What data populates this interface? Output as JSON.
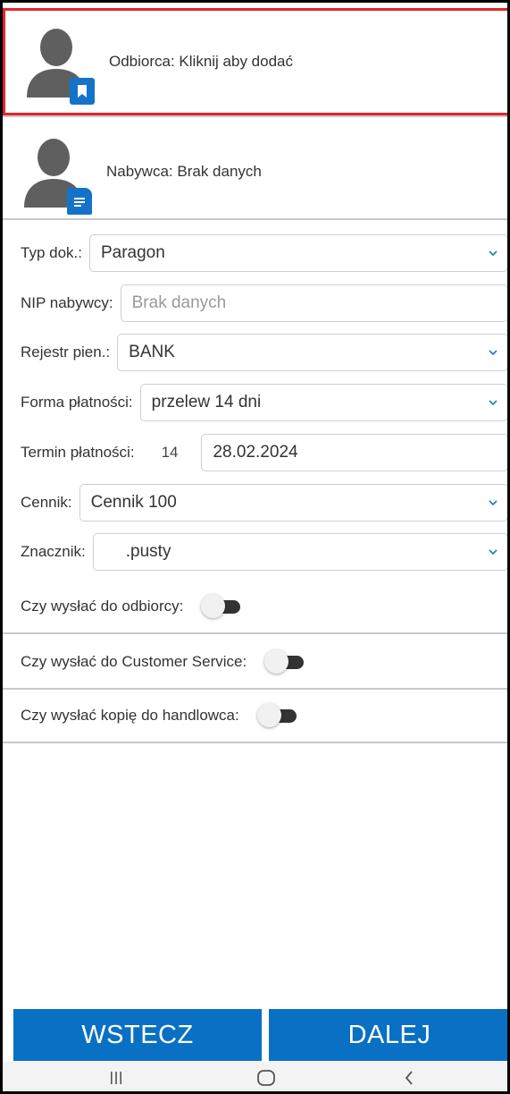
{
  "recipient": {
    "text": "Odbiorca: Kliknij aby dodać",
    "icon": "recipient-card-icon"
  },
  "buyer": {
    "text": "Nabywca: Brak danych",
    "icon": "document-icon"
  },
  "form": {
    "doc_type": {
      "label": "Typ dok.:",
      "value": "Paragon"
    },
    "buyer_nip": {
      "label": "NIP nabywcy:",
      "placeholder": "Brak danych"
    },
    "cash_register": {
      "label": "Rejestr pien.:",
      "value": "BANK"
    },
    "payment_form": {
      "label": "Forma płatności:",
      "value": "przelew 14 dni"
    },
    "payment_term": {
      "label": "Termin płatności:",
      "days": "14",
      "date": "28.02.2024"
    },
    "price_list": {
      "label": "Cennik:",
      "value": "Cennik 100"
    },
    "marker": {
      "label": "Znacznik:",
      "value": ".pusty"
    }
  },
  "toggles": [
    {
      "label": "Czy wysłać do odbiorcy:",
      "on": false
    },
    {
      "label": "Czy wysłać do Customer Service:",
      "on": false
    },
    {
      "label": "Czy wysłać kopię do handlowca:",
      "on": false
    }
  ],
  "buttons": {
    "back": "WSTECZ",
    "next": "DALEJ"
  },
  "colors": {
    "primary": "#0a70c3",
    "selection_border": "#e3242b",
    "avatar": "#5f5f5f"
  },
  "nav": {
    "icons": [
      "recent-apps-icon",
      "home-icon",
      "back-icon"
    ]
  }
}
